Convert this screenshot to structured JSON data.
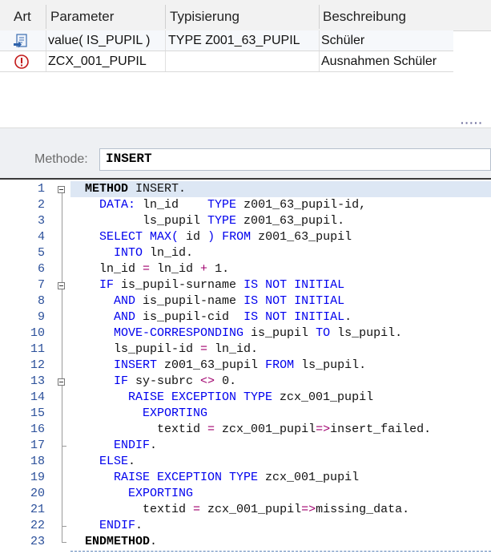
{
  "params_table": {
    "headers": [
      "Art",
      "Parameter",
      "Typisierung",
      "Beschreibung"
    ],
    "rows": [
      {
        "icon": "import-parameter-icon",
        "parameter": "value( IS_PUPIL )",
        "typing": "TYPE Z001_63_PUPIL",
        "description": "Schüler"
      },
      {
        "icon": "exception-icon",
        "parameter": "ZCX_001_PUPIL",
        "typing": "",
        "description": "Ausnahmen Schüler"
      }
    ]
  },
  "splitter": {
    "handle": "·····"
  },
  "method": {
    "label": "Methode:",
    "value": "INSERT"
  },
  "editor": {
    "line_numbers": [
      "1",
      "2",
      "3",
      "4",
      "5",
      "6",
      "7",
      "8",
      "9",
      "10",
      "11",
      "12",
      "13",
      "14",
      "15",
      "16",
      "17",
      "18",
      "19",
      "20",
      "21",
      "22",
      "23"
    ],
    "lines": [
      [
        {
          "t": "  "
        },
        {
          "t": "METHOD",
          "s": "bd"
        },
        {
          "t": " INSERT."
        }
      ],
      [
        {
          "t": "    "
        },
        {
          "t": "DATA:",
          "s": "kw"
        },
        {
          "t": " ln_id    "
        },
        {
          "t": "TYPE",
          "s": "kw"
        },
        {
          "t": " z001_63_pupil-id,"
        }
      ],
      [
        {
          "t": "          ls_pupil "
        },
        {
          "t": "TYPE",
          "s": "kw"
        },
        {
          "t": " z001_63_pupil."
        }
      ],
      [
        {
          "t": "    "
        },
        {
          "t": "SELECT MAX(",
          "s": "kw"
        },
        {
          "t": " id "
        },
        {
          "t": ")",
          "s": "kw"
        },
        {
          "t": " "
        },
        {
          "t": "FROM",
          "s": "kw"
        },
        {
          "t": " z001_63_pupil"
        }
      ],
      [
        {
          "t": "      "
        },
        {
          "t": "INTO",
          "s": "kw"
        },
        {
          "t": " ln_id."
        }
      ],
      [
        {
          "t": "    ln_id "
        },
        {
          "t": "=",
          "s": "op"
        },
        {
          "t": " ln_id "
        },
        {
          "t": "+",
          "s": "op"
        },
        {
          "t": " 1."
        }
      ],
      [
        {
          "t": "    "
        },
        {
          "t": "IF",
          "s": "kw"
        },
        {
          "t": " is_pupil-surname "
        },
        {
          "t": "IS NOT INITIAL",
          "s": "kw"
        }
      ],
      [
        {
          "t": "      "
        },
        {
          "t": "AND",
          "s": "kw"
        },
        {
          "t": " is_pupil-name "
        },
        {
          "t": "IS NOT INITIAL",
          "s": "kw"
        }
      ],
      [
        {
          "t": "      "
        },
        {
          "t": "AND",
          "s": "kw"
        },
        {
          "t": " is_pupil-cid  "
        },
        {
          "t": "IS NOT INITIAL",
          "s": "kw"
        },
        {
          "t": "."
        }
      ],
      [
        {
          "t": "      "
        },
        {
          "t": "MOVE-CORRESPONDING",
          "s": "kw"
        },
        {
          "t": " is_pupil "
        },
        {
          "t": "TO",
          "s": "kw"
        },
        {
          "t": " ls_pupil."
        }
      ],
      [
        {
          "t": "      ls_pupil-id "
        },
        {
          "t": "=",
          "s": "op"
        },
        {
          "t": " ln_id."
        }
      ],
      [
        {
          "t": "      "
        },
        {
          "t": "INSERT",
          "s": "kw"
        },
        {
          "t": " z001_63_pupil "
        },
        {
          "t": "FROM",
          "s": "kw"
        },
        {
          "t": " ls_pupil."
        }
      ],
      [
        {
          "t": "      "
        },
        {
          "t": "IF",
          "s": "kw"
        },
        {
          "t": " sy-subrc "
        },
        {
          "t": "<>",
          "s": "op"
        },
        {
          "t": " 0."
        }
      ],
      [
        {
          "t": "        "
        },
        {
          "t": "RAISE EXCEPTION TYPE",
          "s": "kw"
        },
        {
          "t": " zcx_001_pupil"
        }
      ],
      [
        {
          "t": "          "
        },
        {
          "t": "EXPORTING",
          "s": "kw"
        }
      ],
      [
        {
          "t": "            textid "
        },
        {
          "t": "=",
          "s": "op"
        },
        {
          "t": " zcx_001_pupil"
        },
        {
          "t": "=>",
          "s": "op"
        },
        {
          "t": "insert_failed."
        }
      ],
      [
        {
          "t": "      "
        },
        {
          "t": "ENDIF",
          "s": "kw"
        },
        {
          "t": "."
        }
      ],
      [
        {
          "t": "    "
        },
        {
          "t": "ELSE",
          "s": "kw"
        },
        {
          "t": "."
        }
      ],
      [
        {
          "t": "      "
        },
        {
          "t": "RAISE EXCEPTION TYPE",
          "s": "kw"
        },
        {
          "t": " zcx_001_pupil"
        }
      ],
      [
        {
          "t": "        "
        },
        {
          "t": "EXPORTING",
          "s": "kw"
        }
      ],
      [
        {
          "t": "          textid "
        },
        {
          "t": "=",
          "s": "op"
        },
        {
          "t": " zcx_001_pupil"
        },
        {
          "t": "=>",
          "s": "op"
        },
        {
          "t": "missing_data."
        }
      ],
      [
        {
          "t": "    "
        },
        {
          "t": "ENDIF",
          "s": "kw"
        },
        {
          "t": "."
        }
      ],
      [
        {
          "t": "  "
        },
        {
          "t": "ENDMETHOD",
          "s": "bd"
        },
        {
          "t": "."
        }
      ]
    ]
  }
}
